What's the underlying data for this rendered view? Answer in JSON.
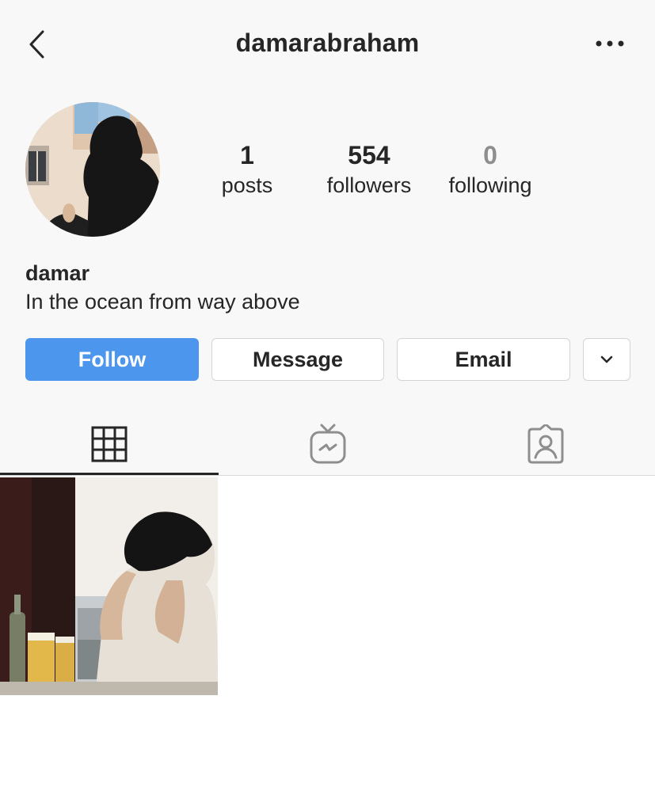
{
  "nav": {
    "title": "damarabraham"
  },
  "profile": {
    "display_name": "damar",
    "bio": "In the ocean from way above"
  },
  "stats": {
    "posts": {
      "value": "1",
      "label": "posts"
    },
    "followers": {
      "value": "554",
      "label": "followers"
    },
    "following": {
      "value": "0",
      "label": "following"
    }
  },
  "actions": {
    "follow": "Follow",
    "message": "Message",
    "email": "Email"
  },
  "tabs": [
    {
      "icon": "grid-icon",
      "active": true
    },
    {
      "icon": "igtv-icon",
      "active": false
    },
    {
      "icon": "tagged-icon",
      "active": false
    }
  ],
  "colors": {
    "accent": "#4c97ed",
    "text": "#262626",
    "muted": "#8e8e8e",
    "background": "#f8f8f9"
  }
}
